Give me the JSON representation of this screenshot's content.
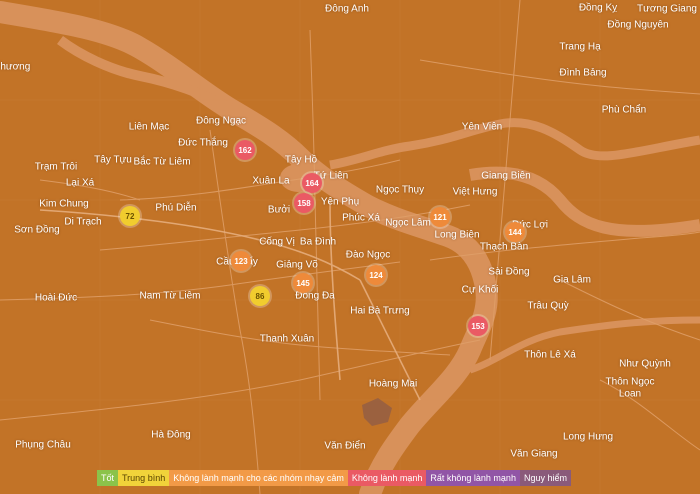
{
  "colors": {
    "land": "#c27327",
    "river": "#d8915a",
    "road": "#e0a06a"
  },
  "places": [
    {
      "id": "dong-anh",
      "name": "Đông Anh"
    },
    {
      "id": "dong-ky",
      "name": "Đồng Kỵ"
    },
    {
      "id": "tuong-giang",
      "name": "Tương Giang"
    },
    {
      "id": "dong-nguyen",
      "name": "Đồng Nguyên"
    },
    {
      "id": "phuong",
      "name": "Phương"
    },
    {
      "id": "trang-ha",
      "name": "Trang Hạ"
    },
    {
      "id": "dinh-bang",
      "name": "Đình Bảng"
    },
    {
      "id": "phu-chan",
      "name": "Phù Chẩn"
    },
    {
      "id": "lien-mac",
      "name": "Liên Mạc"
    },
    {
      "id": "dong-ngac",
      "name": "Đông Ngạc"
    },
    {
      "id": "duc-thang",
      "name": "Đức Thắng"
    },
    {
      "id": "yen-vien",
      "name": "Yên Viên"
    },
    {
      "id": "tram-troi",
      "name": "Trạm Trôi"
    },
    {
      "id": "tay-tuu",
      "name": "Tây Tựu"
    },
    {
      "id": "bac-tu-liem",
      "name": "Bắc Từ Liêm"
    },
    {
      "id": "tay-ho",
      "name": "Tây Hồ"
    },
    {
      "id": "tu-lien",
      "name": "Tứ Liên"
    },
    {
      "id": "xuan-la",
      "name": "Xuân La"
    },
    {
      "id": "lai-xa",
      "name": "Lại Xá"
    },
    {
      "id": "ngoc-thuy",
      "name": "Ngọc Thụy"
    },
    {
      "id": "viet-hung",
      "name": "Việt Hưng"
    },
    {
      "id": "giang-bien",
      "name": "Giang Biên"
    },
    {
      "id": "kim-chung",
      "name": "Kim Chung"
    },
    {
      "id": "phu-dien",
      "name": "Phú Diễn"
    },
    {
      "id": "buoi",
      "name": "Bưởi"
    },
    {
      "id": "yen-phu",
      "name": "Yên Phụ"
    },
    {
      "id": "di-trach",
      "name": "Di Trạch"
    },
    {
      "id": "son-dong",
      "name": "Sơn Đồng"
    },
    {
      "id": "phuc-xa",
      "name": "Phúc Xá"
    },
    {
      "id": "ngoc-lam",
      "name": "Ngọc Lâm"
    },
    {
      "id": "duc-loi",
      "name": "Đức Lợi"
    },
    {
      "id": "long-bien",
      "name": "Long Biên"
    },
    {
      "id": "cong-vi",
      "name": "Cống Vị"
    },
    {
      "id": "ba-dinh",
      "name": "Ba Đình"
    },
    {
      "id": "thach-ban",
      "name": "Thạch Bàn"
    },
    {
      "id": "cau-giay",
      "name": "Cầu Giấy"
    },
    {
      "id": "dao-ngoc",
      "name": "Đào Ngọc"
    },
    {
      "id": "giang-vo",
      "name": "Giảng Võ"
    },
    {
      "id": "sai-dong",
      "name": "Sài Đồng"
    },
    {
      "id": "gia-lam",
      "name": "Gia Lâm"
    },
    {
      "id": "hoai-duc",
      "name": "Hoài Đức"
    },
    {
      "id": "nam-tu-liem",
      "name": "Nam Từ Liêm"
    },
    {
      "id": "dong-da",
      "name": "Đống Đa"
    },
    {
      "id": "cu-khoi",
      "name": "Cự Khối"
    },
    {
      "id": "trau-quy",
      "name": "Trâu Quỳ"
    },
    {
      "id": "hai-ba-trung",
      "name": "Hai Bà Trưng"
    },
    {
      "id": "thanh-xuan",
      "name": "Thanh Xuân"
    },
    {
      "id": "thon-le-xa",
      "name": "Thôn Lê Xá"
    },
    {
      "id": "nhu-quynh",
      "name": "Như Quỳnh"
    },
    {
      "id": "hoang-mai",
      "name": "Hoàng Mai"
    },
    {
      "id": "thon-ngoc-loan-1",
      "name": "Thôn Ngọc"
    },
    {
      "id": "thon-ngoc-loan-2",
      "name": "Loan"
    },
    {
      "id": "phung-chau",
      "name": "Phụng Châu"
    },
    {
      "id": "ha-dong",
      "name": "Hà Đông"
    },
    {
      "id": "long-hung",
      "name": "Long Hưng"
    },
    {
      "id": "van-dien",
      "name": "Văn Điển"
    },
    {
      "id": "van-giang",
      "name": "Văn Giang"
    }
  ],
  "markers": [
    {
      "id": "m162",
      "value": "162",
      "level": "red"
    },
    {
      "id": "m164",
      "value": "164",
      "level": "red"
    },
    {
      "id": "m158",
      "value": "158",
      "level": "red"
    },
    {
      "id": "m72",
      "value": "72",
      "level": "yellow"
    },
    {
      "id": "m121",
      "value": "121",
      "level": "orange"
    },
    {
      "id": "m144",
      "value": "144",
      "level": "orange"
    },
    {
      "id": "m123",
      "value": "123",
      "level": "orange"
    },
    {
      "id": "m124",
      "value": "124",
      "level": "orange"
    },
    {
      "id": "m145",
      "value": "145",
      "level": "orange"
    },
    {
      "id": "m86",
      "value": "86",
      "level": "yellow"
    },
    {
      "id": "m153",
      "value": "153",
      "level": "red"
    }
  ],
  "legend": {
    "good": "Tốt",
    "moderate": "Trung bình",
    "usg": "Không lành mạnh cho các nhóm nhạy cảm",
    "unhealthy": "Không lành mạnh",
    "very_unhealthy": "Rất không lành mạnh",
    "hazardous": "Nguy hiểm"
  }
}
